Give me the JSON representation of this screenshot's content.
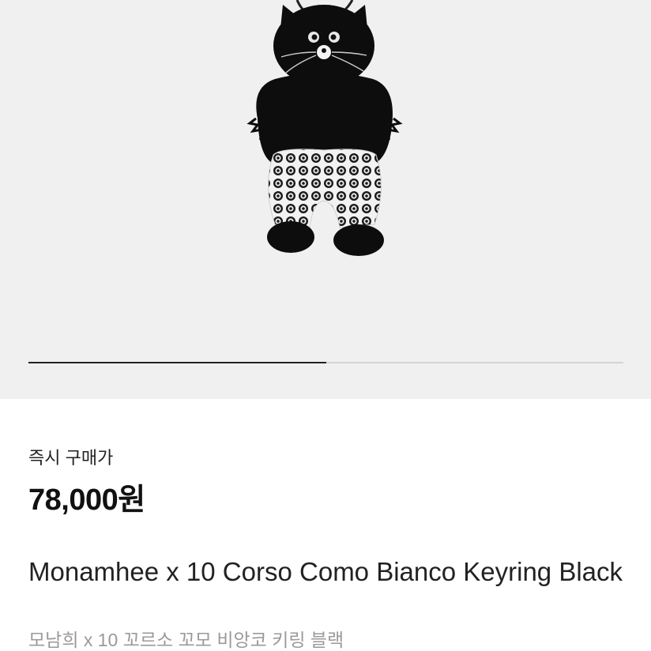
{
  "product": {
    "image_icon": "monamhee-black-cat-keyring-photo",
    "gallery": {
      "progress_fraction": 0.5
    },
    "price_label": "즉시 구매가",
    "price": "78,000원",
    "title": "Monamhee x 10 Corso Como Bianco Keyring Black",
    "subtitle": "모남희 x 10 꼬르소 꼬모 비앙코 키링 블랙"
  },
  "colors": {
    "hero_background": "#f0f0f0",
    "progress_active": "#222222",
    "progress_track": "#d4d4d4",
    "subtitle_gray": "#9a9a9a"
  }
}
